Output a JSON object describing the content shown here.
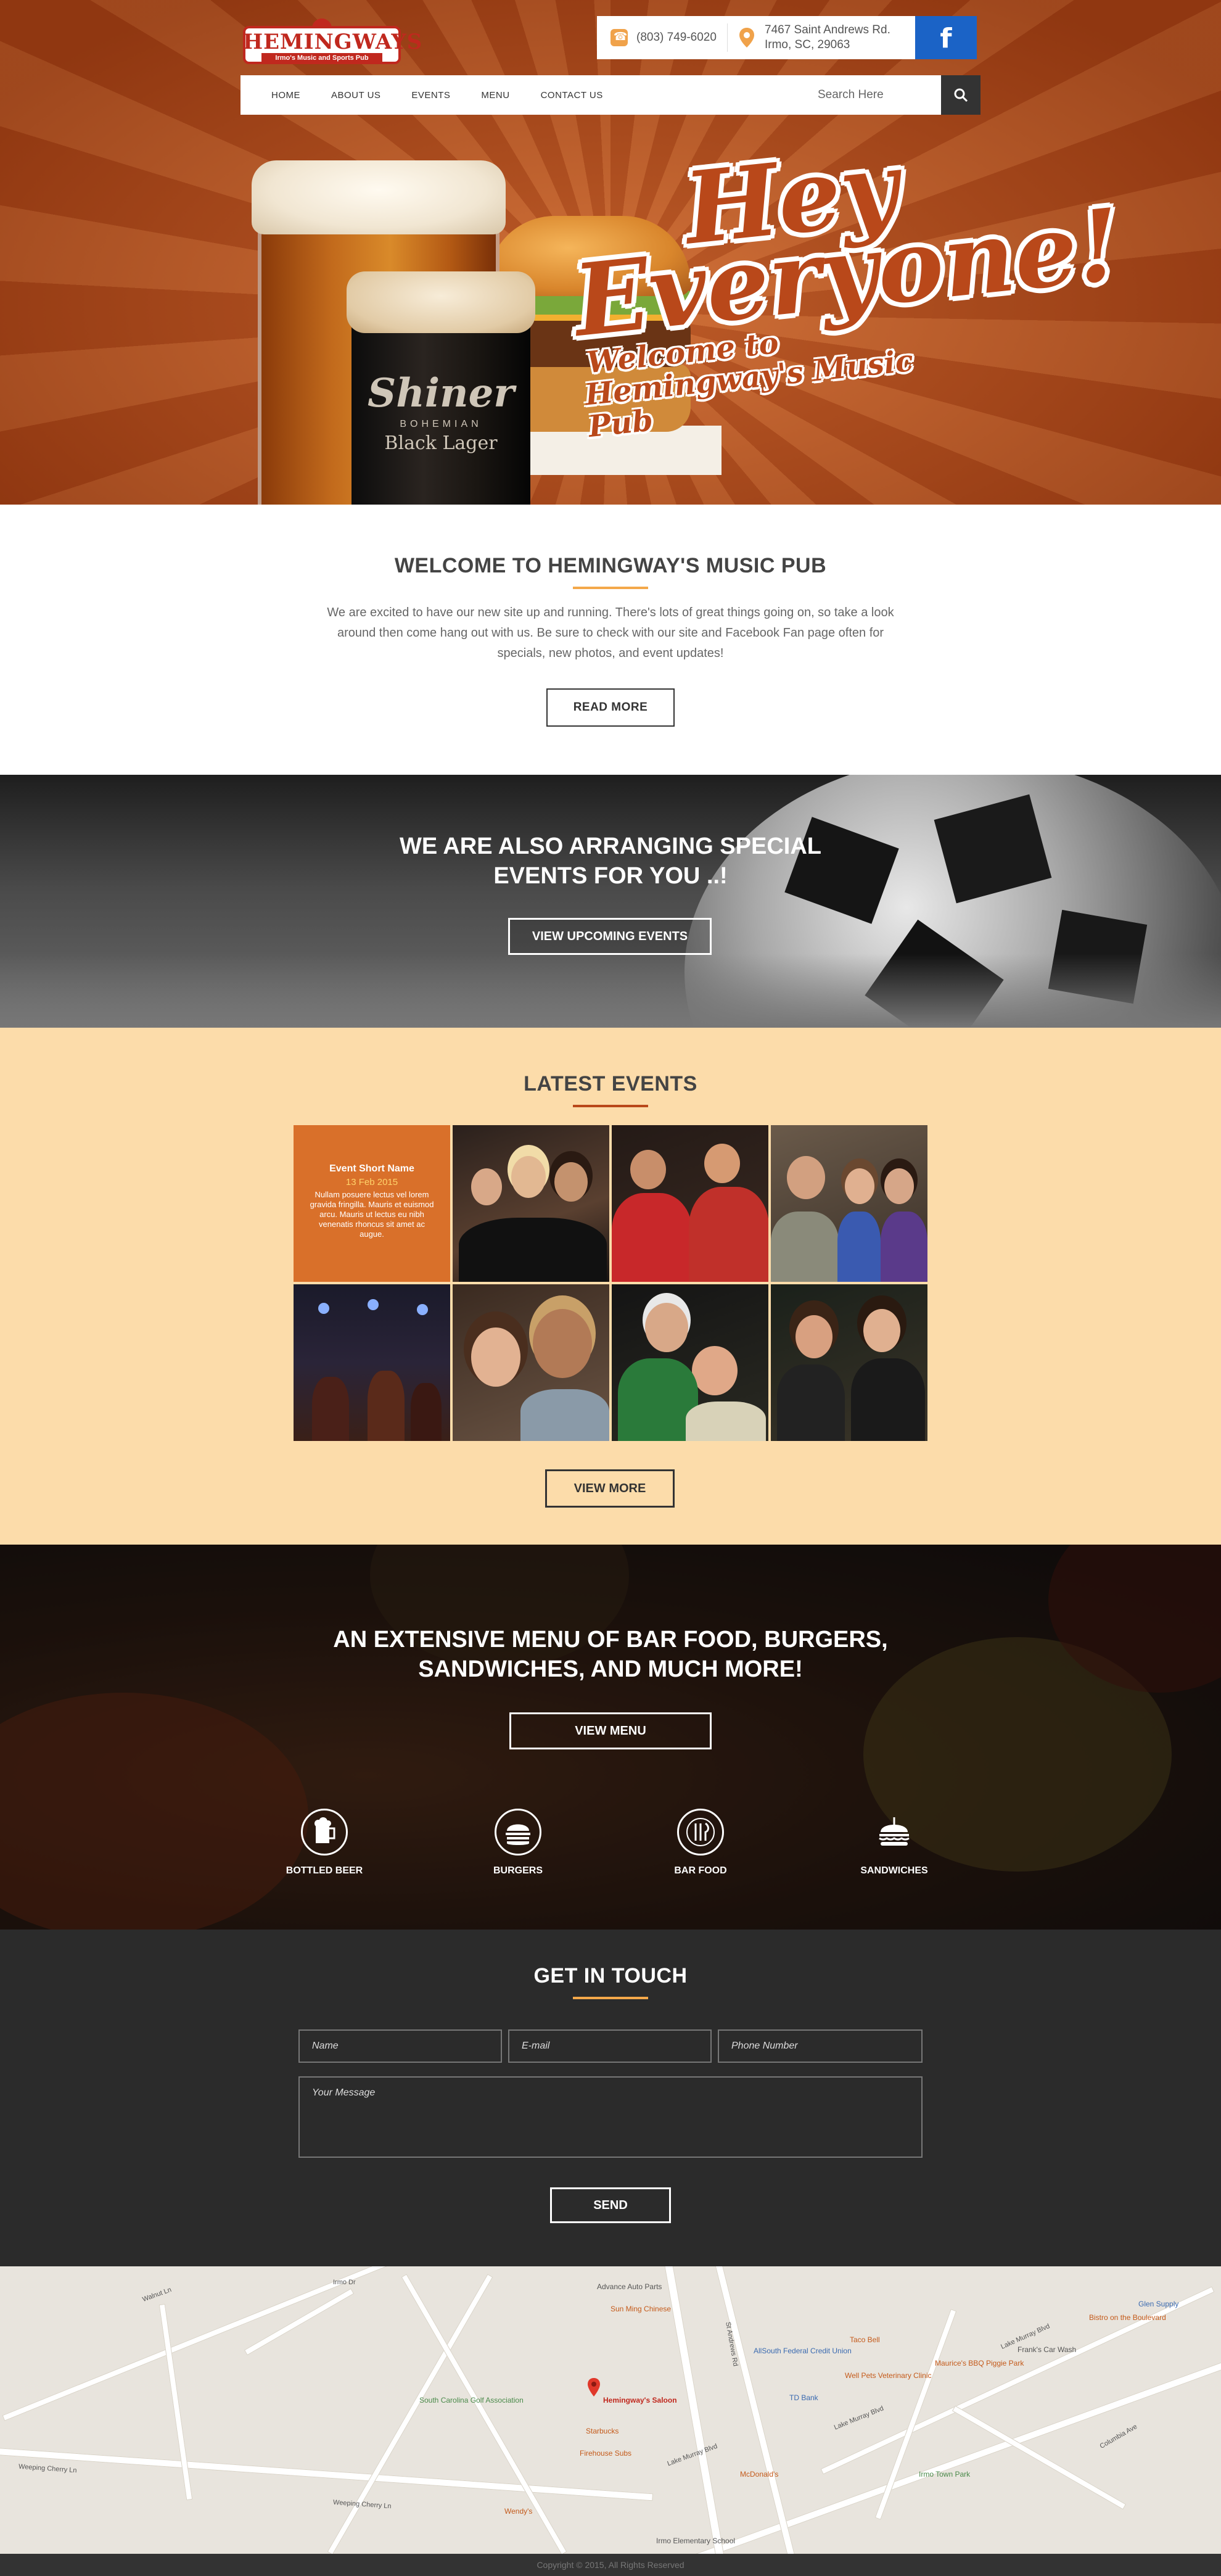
{
  "header": {
    "logo": {
      "name": "HEMINGWAYS",
      "tagline": "Irmo's Music and Sports Pub"
    },
    "phone": "(803) 749-6020",
    "address_line1": "7467 Saint Andrews Rd.",
    "address_line2": "Irmo, SC, 29063",
    "facebook_label": "f"
  },
  "nav": {
    "items": [
      "HOME",
      "ABOUT US",
      "EVENTS",
      "MENU",
      "CONTACT US"
    ],
    "search_placeholder": "Search Here"
  },
  "hero": {
    "line1": "Hey",
    "line2": "Everyone!",
    "line3": "Welcome to",
    "line4": "Hemingway's Music Pub",
    "beer_brand": "Shiner",
    "beer_sub": "BOHEMIAN",
    "beer_name": "Black Lager"
  },
  "welcome": {
    "title": "WELCOME TO HEMINGWAY'S MUSIC PUB",
    "text": "We are excited to have our new site up and running. There's lots of great things going on, so take a look around then come hang out with us. Be sure to check with our site and Facebook Fan page often for specials, new photos, and event updates!",
    "button": "READ MORE"
  },
  "special": {
    "title_line1": "WE ARE ALSO ARRANGING SPECIAL",
    "title_line2": "EVENTS FOR YOU ..!",
    "button": "VIEW UPCOMING EVENTS"
  },
  "events": {
    "title": "LATEST EVENTS",
    "featured": {
      "name": "Event Short Name",
      "date": "13 Feb 2015",
      "text": "Nullam posuere lectus vel lorem gravida fringilla. Mauris et euismod arcu. Mauris ut lectus eu nibh venenatis rhoncus sit amet ac augue."
    },
    "button": "VIEW MORE"
  },
  "menu": {
    "title_line1": "AN EXTENSIVE MENU OF BAR FOOD, BURGERS,",
    "title_line2": "SANDWICHES, AND MUCH MORE!",
    "button": "VIEW MENU",
    "features": [
      "BOTTLED BEER",
      "BURGERS",
      "BAR FOOD",
      "SANDWICHES"
    ]
  },
  "contact": {
    "title": "GET IN TOUCH",
    "name_placeholder": "Name",
    "email_placeholder": "E-mail",
    "phone_placeholder": "Phone Number",
    "message_placeholder": "Your Message",
    "button": "SEND"
  },
  "map": {
    "marker_label": "Hemingway's Saloon",
    "labels": [
      "Advance Auto Parts",
      "Sun Ming Chinese",
      "AllSouth Federal Credit Union",
      "TD Bank",
      "Taco Bell",
      "Well Pets Veterinary Clinic",
      "Maurice's BBQ Piggie Park",
      "Bistro on the Boulevard",
      "Glen Supply",
      "Frank's Car Wash",
      "South Carolina Golf Association",
      "Starbucks",
      "Firehouse Subs",
      "McDonald's",
      "Wendy's",
      "Irmo Elementary School",
      "Irmo Town Park",
      "Lake Murray Blvd",
      "Weeping Cherry Ln",
      "St Andrews Rd",
      "Walnut Ln",
      "Irmo Dr",
      "Columbia Ave"
    ]
  },
  "footer": {
    "text": "Copyright © 2015, All Rights Reserved"
  },
  "colors": {
    "accent": "#f4a84a",
    "brand_red": "#c0281e",
    "facebook": "#1b63c6",
    "events_bg": "#fcdcaa",
    "dark": "#2b2b2b"
  }
}
